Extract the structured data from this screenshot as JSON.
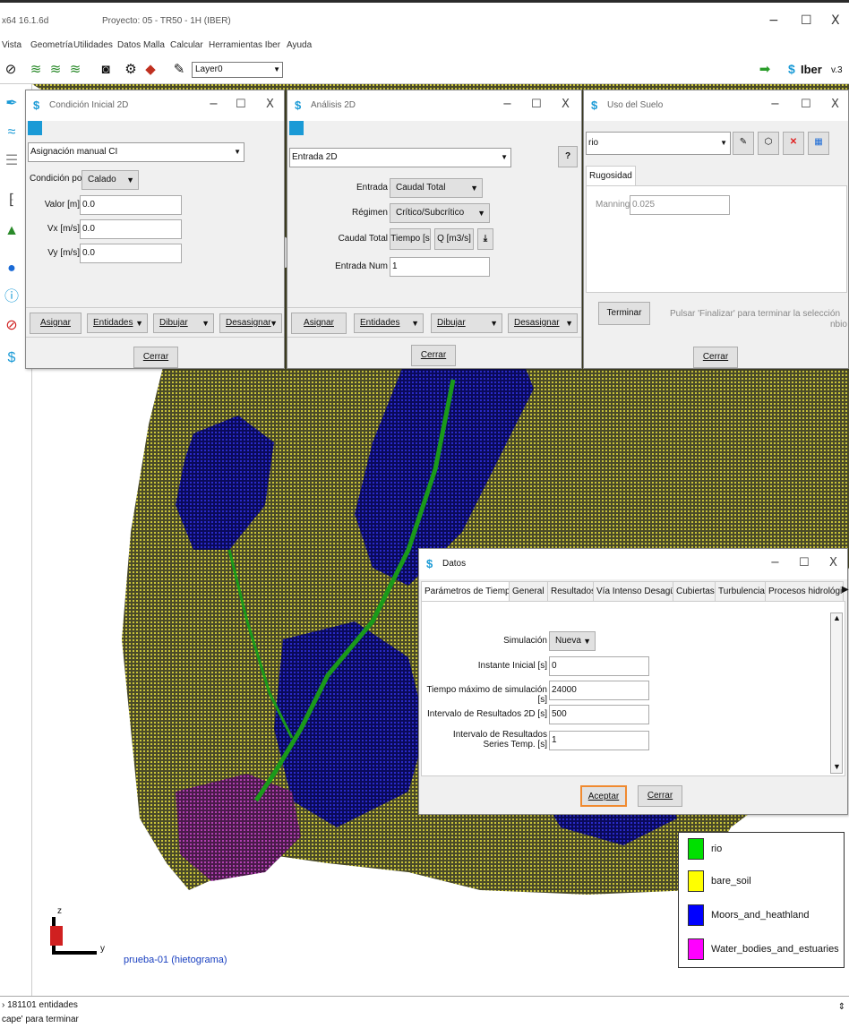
{
  "app": {
    "version": "x64 16.1.6d",
    "project": "Proyecto: 05 - TR50 - 1H (IBER)",
    "window_controls": [
      "−",
      "☐",
      "X"
    ],
    "brand": "Iber",
    "brand_version": "v.3"
  },
  "menu": [
    "Vista",
    "Geometría",
    "Utilidades",
    "Datos",
    "Malla",
    "Calcular",
    "Herramientas Iber",
    "Ayuda"
  ],
  "toolbar": {
    "layer": "Layer0"
  },
  "ci_dialog": {
    "title": "Condición Inicial 2D",
    "mode": "Asignación manual CI",
    "cond_label": "Condición por",
    "cond_value": "Calado",
    "fields": [
      {
        "label": "Valor [m]",
        "value": "0.0"
      },
      {
        "label": "Vx [m/s]",
        "value": "0.0"
      },
      {
        "label": "Vy [m/s]",
        "value": "0.0"
      }
    ],
    "assign": "Asignar",
    "entities": "Entidades",
    "draw": "Dibujar",
    "unassign": "Desasignar",
    "close": "Cerrar"
  },
  "a2d_dialog": {
    "title": "Análisis 2D",
    "mode": "Entrada 2D",
    "help": "?",
    "rows": [
      {
        "label": "Entrada",
        "value": "Caudal Total"
      },
      {
        "label": "Régimen",
        "value": "Crítico/Subcrítico"
      }
    ],
    "caudal_label": "Caudal Total",
    "caudal_btn1": "Tiempo [s",
    "caudal_btn2": "Q [m3/s]",
    "num_label": "Entrada Num",
    "num_value": "1",
    "assign": "Asignar",
    "entities": "Entidades",
    "draw": "Dibujar",
    "unassign": "Desasignar",
    "close": "Cerrar"
  },
  "uso_dialog": {
    "title": "Uso del Suelo",
    "material": "rio",
    "tab": "Rugosidad",
    "manning_label": "Manning",
    "manning_value": "0.025",
    "finish": "Terminar",
    "hint": "Pulsar 'Finalizar' para terminar la selección",
    "cut": "nbio",
    "close": "Cerrar"
  },
  "datos_dialog": {
    "title": "Datos",
    "tabs": [
      "Parámetros de Tiempo",
      "General",
      "Resultados",
      "Vía Intenso Desagüe",
      "Cubiertas",
      "Turbulencia",
      "Procesos hidrológico"
    ],
    "sim_label": "Simulación",
    "sim_value": "Nueva",
    "fields": [
      {
        "label": "Instante Inicial [s]",
        "value": "0"
      },
      {
        "label": "Tiempo máximo de simulación [s]",
        "value": "24000"
      },
      {
        "label": "Intervalo de Resultados 2D [s]",
        "value": "500"
      },
      {
        "label": "Intervalo de Resultados Series Temp. [s]",
        "value": "1"
      }
    ],
    "accept": "Aceptar",
    "close": "Cerrar"
  },
  "legend": [
    {
      "name": "rio",
      "color": "#00e000"
    },
    {
      "name": "bare_soil",
      "color": "#ffff00"
    },
    {
      "name": "Moors_and_heathland",
      "color": "#0000ff"
    },
    {
      "name": "Water_bodies_and_estuaries",
      "color": "#ff00ff"
    }
  ],
  "canvas": {
    "label": "prueba-01 (hietograma)",
    "axis_z": "z",
    "axis_y": "y"
  },
  "status": [
    "› 181101 entidades",
    "cape' para terminar"
  ]
}
